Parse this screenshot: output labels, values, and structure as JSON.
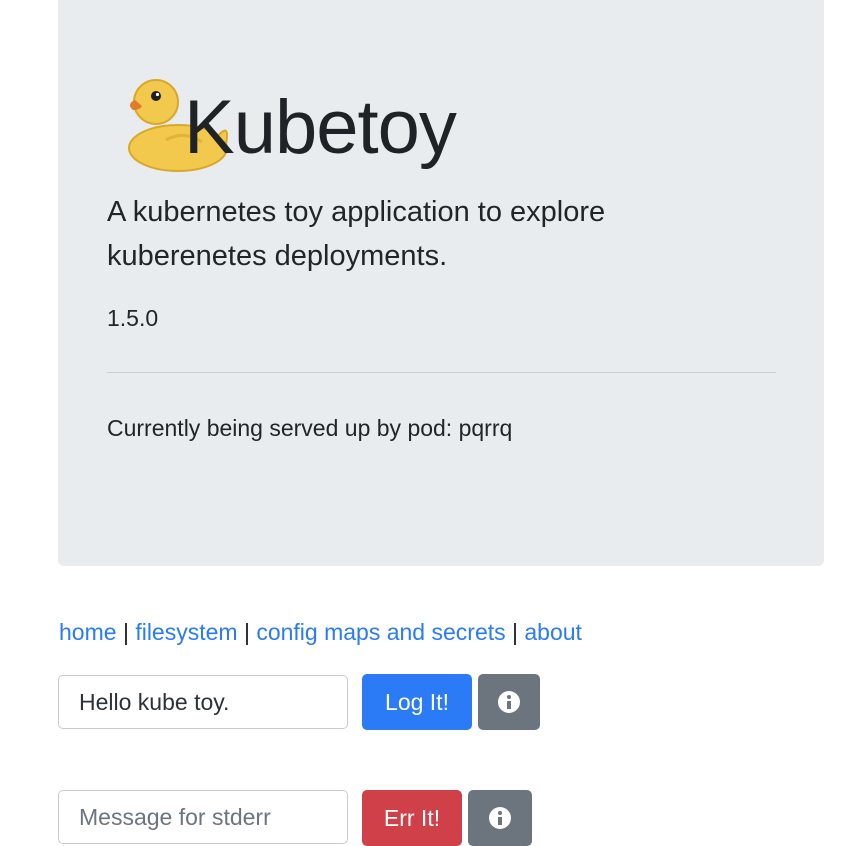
{
  "header": {
    "logo_icon": "rubber-duck-icon",
    "title": "Kubetoy",
    "description": "A kubernetes toy application to explore kuberenetes deployments.",
    "version": "1.5.0",
    "served_by": "Currently being served up by pod: pqrrq"
  },
  "nav": {
    "links": [
      "home",
      "filesystem",
      "config maps and secrets",
      "about"
    ],
    "separator": "|"
  },
  "log_form": {
    "input_value": "Hello kube toy.",
    "button_label": "Log It!",
    "info_icon": "info-circle-icon"
  },
  "err_form": {
    "placeholder": "Message for stderr",
    "button_label": "Err It!",
    "info_icon": "info-circle-icon"
  },
  "colors": {
    "jumbotron_bg": "#e9ecef",
    "link": "#2a7bf5",
    "primary": "#2a7bf5",
    "danger": "#d04048",
    "secondary": "#6c757d"
  }
}
